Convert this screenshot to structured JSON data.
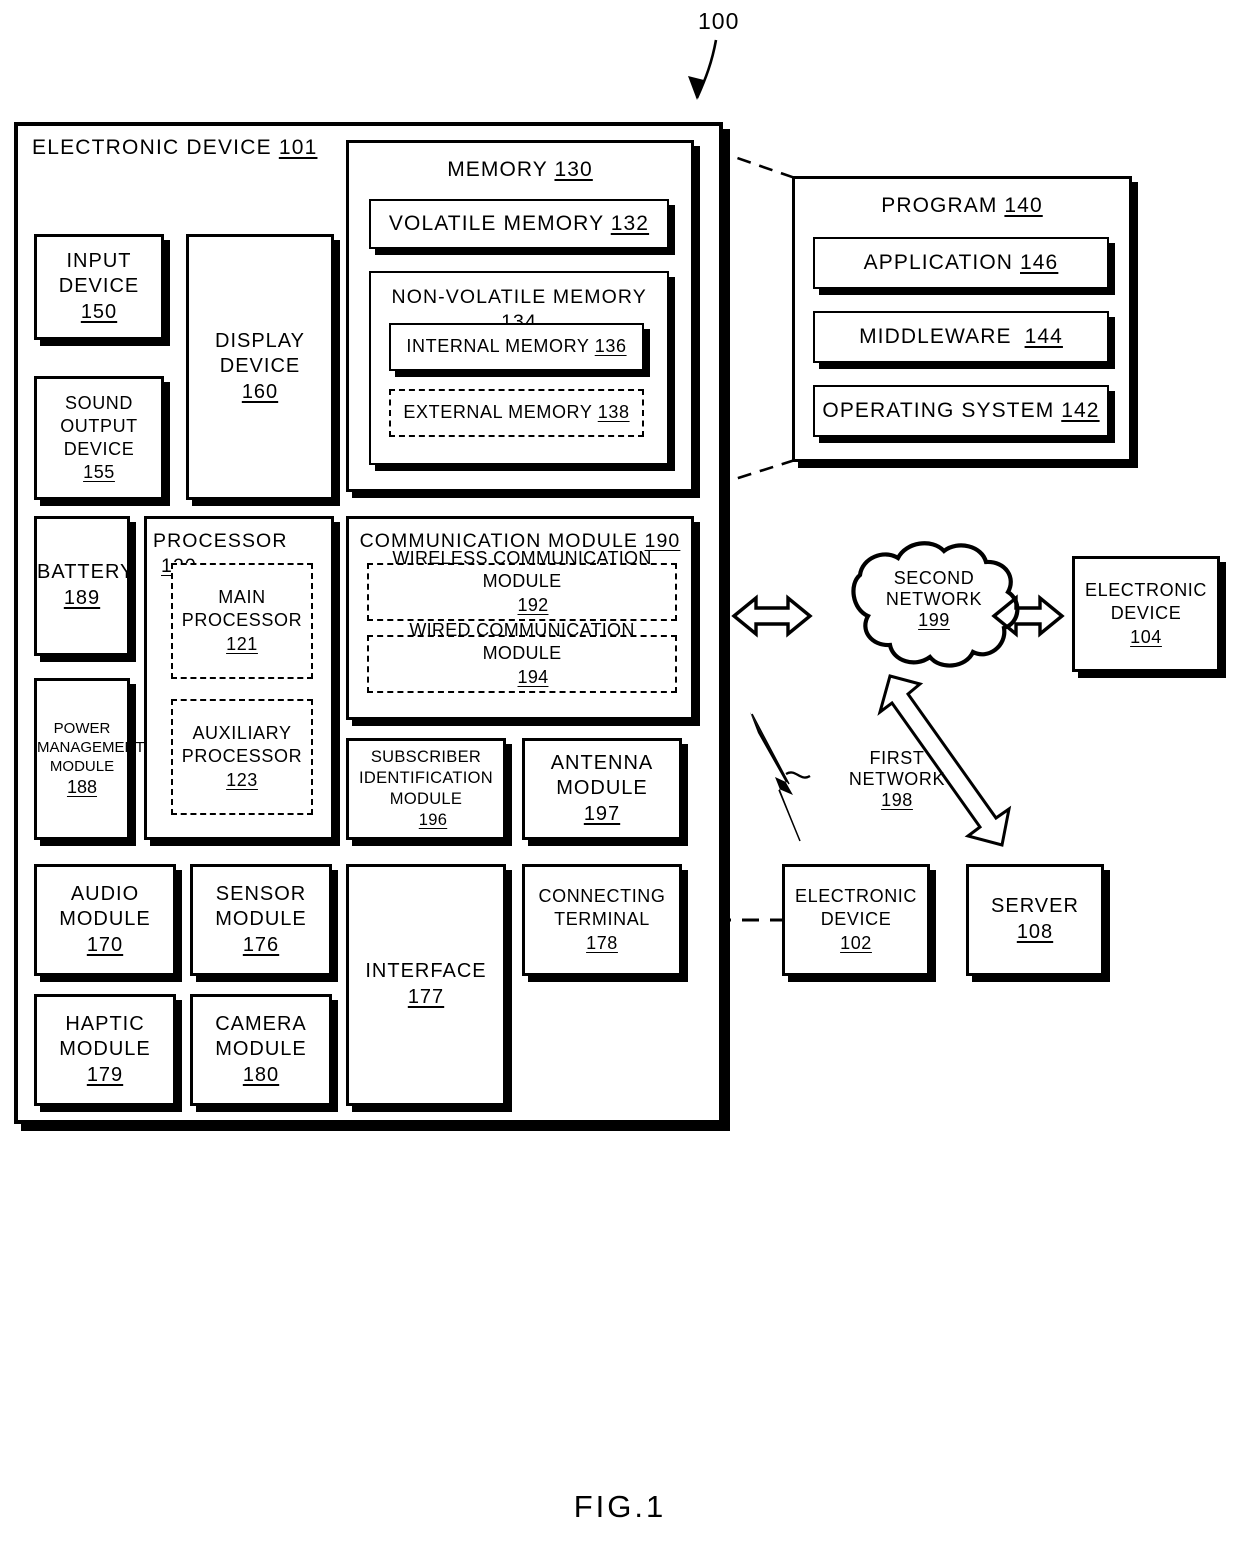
{
  "figure": {
    "caption": "FIG.1",
    "system_ref": "100"
  },
  "electronic_device": {
    "title": "ELECTRONIC DEVICE",
    "ref": "101",
    "input_device": {
      "line1": "INPUT",
      "line2": "DEVICE",
      "ref": "150"
    },
    "sound_output_device": {
      "line1": "SOUND",
      "line2": "OUTPUT",
      "line3": "DEVICE",
      "ref": "155"
    },
    "display_device": {
      "line1": "DISPLAY",
      "line2": "DEVICE",
      "ref": "160"
    },
    "battery": {
      "line1": "BATTERY",
      "ref": "189"
    },
    "power_management_module": {
      "line1": "POWER",
      "line2": "MANAGEMENT",
      "line3": "MODULE",
      "ref": "188"
    },
    "audio_module": {
      "line1": "AUDIO",
      "line2": "MODULE",
      "ref": "170"
    },
    "sensor_module": {
      "line1": "SENSOR",
      "line2": "MODULE",
      "ref": "176"
    },
    "haptic_module": {
      "line1": "HAPTIC",
      "line2": "MODULE",
      "ref": "179"
    },
    "camera_module": {
      "line1": "CAMERA",
      "line2": "MODULE",
      "ref": "180"
    },
    "interface": {
      "line1": "INTERFACE",
      "ref": "177"
    },
    "connecting_terminal": {
      "line1": "CONNECTING",
      "line2": "TERMINAL",
      "ref": "178"
    },
    "subscriber_identification_module": {
      "line1": "SUBSCRIBER",
      "line2": "IDENTIFICATION",
      "line3": "MODULE",
      "ref": "196"
    },
    "antenna_module": {
      "line1": "ANTENNA",
      "line2": "MODULE",
      "ref": "197"
    }
  },
  "memory": {
    "title": "MEMORY",
    "ref": "130",
    "volatile": {
      "title": "VOLATILE MEMORY",
      "ref": "132"
    },
    "non_volatile": {
      "title": "NON-VOLATILE MEMORY",
      "ref": "134",
      "internal": {
        "title": "INTERNAL MEMORY",
        "ref": "136"
      },
      "external": {
        "title": "EXTERNAL MEMORY",
        "ref": "138"
      }
    }
  },
  "processor": {
    "title": "PROCESSOR",
    "ref": "120",
    "main": {
      "line1": "MAIN",
      "line2": "PROCESSOR",
      "ref": "121"
    },
    "auxiliary": {
      "line1": "AUXILIARY",
      "line2": "PROCESSOR",
      "ref": "123"
    }
  },
  "communication_module": {
    "title": "COMMUNICATION MODULE",
    "ref": "190",
    "wireless": {
      "line1": "WIRELESS COMMUNICATION",
      "line2": "MODULE",
      "ref": "192"
    },
    "wired": {
      "line1": "WIRED COMMUNICATION",
      "line2": "MODULE",
      "ref": "194"
    }
  },
  "program": {
    "title": "PROGRAM",
    "ref": "140",
    "application": {
      "title": "APPLICATION",
      "ref": "146"
    },
    "middleware": {
      "title": "MIDDLEWARE",
      "ref": "144"
    },
    "operating_system": {
      "title": "OPERATING SYSTEM",
      "ref": "142"
    }
  },
  "network": {
    "second_network": {
      "line1": "SECOND",
      "line2": "NETWORK",
      "ref": "199"
    },
    "first_network": {
      "line1": "FIRST",
      "line2": "NETWORK",
      "ref": "198"
    }
  },
  "external_nodes": {
    "electronic_device_104": {
      "line1": "ELECTRONIC",
      "line2": "DEVICE",
      "ref": "104"
    },
    "electronic_device_102": {
      "line1": "ELECTRONIC",
      "line2": "DEVICE",
      "ref": "102"
    },
    "server_108": {
      "line1": "SERVER",
      "ref": "108"
    }
  }
}
